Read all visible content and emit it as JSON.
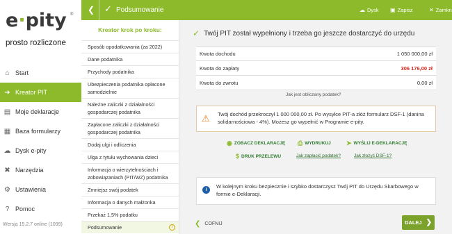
{
  "brand": {
    "name_a": "e",
    "name_dot": "·",
    "name_b": "pity",
    "reg": "®",
    "tagline": "prosto rozliczone"
  },
  "nav": [
    {
      "icon": "home-icon",
      "glyph": "⌂",
      "label": "Start"
    },
    {
      "icon": "arrow-right-icon",
      "glyph": "➜",
      "label": "Kreator PIT",
      "active": true
    },
    {
      "icon": "document-icon",
      "glyph": "▤",
      "label": "Moje deklaracje"
    },
    {
      "icon": "folder-icon",
      "glyph": "▦",
      "label": "Baza formularzy"
    },
    {
      "icon": "cloud-icon",
      "glyph": "☁",
      "label": "Dysk e-pity"
    },
    {
      "icon": "tools-icon",
      "glyph": "✖",
      "label": "Narzędzia"
    },
    {
      "icon": "gear-icon",
      "glyph": "⚙",
      "label": "Ustawienia"
    },
    {
      "icon": "help-icon",
      "glyph": "?",
      "label": "Pomoc"
    }
  ],
  "version": "Wersja 15.2.7 online (1099)",
  "topbar": {
    "title": "Podsumowanie",
    "disk": "Dysk",
    "save": "Zapisz",
    "close": "Zamknij"
  },
  "steps": {
    "heading": "Kreator krok po kroku:",
    "items": [
      "Sposób opodatkowania (za 2022)",
      "Dane podatnika",
      "Przychody podatnika",
      "Ubezpieczenia podatnika opłacone samodzielnie",
      "Należne zaliczki z działalności gospodarczej podatnika",
      "Zapłacone zaliczki z działalności gospodarczej podatnika",
      "Dodaj ulgi i odliczenia",
      "Ulga z tytułu wychowania dzieci",
      "Informacja o wierzytelnościach i zobowiązaniach (PIT/WZ) podatnika",
      "Zmniejsz swój podatek",
      "Informacja o danych małżonka",
      "Przekaż 1,5% podatku",
      "Podsumowanie"
    ]
  },
  "main": {
    "heading": "Twój PIT został wypełniony i trzeba go jeszcze dostarczyć do urzędu",
    "table": [
      {
        "label": "Kwota dochodu",
        "value": "1 050 000,00 zł"
      },
      {
        "label": "Kwota do zapłaty",
        "value": "306 176,00 zł",
        "highlight": "#d2261a"
      },
      {
        "label": "Kwota do zwrotu",
        "value": "0,00 zł"
      }
    ],
    "calc_link": "Jak jest obliczany podatek?",
    "warning": "Twój dochód przekroczył 1 000 000,00 zł. Po wysyłce PIT-a złóż formularz DSF-1 (danina solidarnościowa - 4%). Możesz go wypełnić w Programie e-pity.",
    "actions": {
      "view": "ZOBACZ DEKLARACJĘ",
      "print": "WYDRUKUJ",
      "send": "WYŚLIJ E-DEKLARACJĘ",
      "transfer": "DRUK PRZELEWU",
      "how_pay": "Jak zapłacić podatek?",
      "how_dsf": "Jak złożyć DSF-1?"
    },
    "info": "W kolejnym kroku bezpiecznie i szybko dostarczysz Twój PIT do Urzędu Skarbowego w formie e-Deklaracji.",
    "back": "COFNIJ",
    "next": "DALEJ"
  },
  "colors": {
    "accent": "#8cba2a",
    "red": "#d2261a",
    "warning": "#e07b1a",
    "info": "#1e5fa8"
  }
}
